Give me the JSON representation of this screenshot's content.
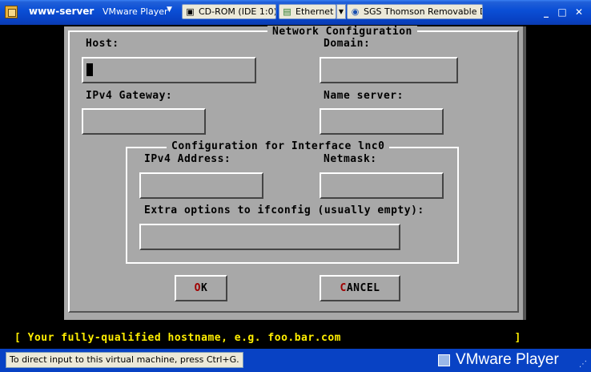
{
  "window": {
    "title": "www-server",
    "menu_label": "VMware Player",
    "devices": [
      {
        "label": "CD-ROM (IDE 1:0)",
        "icon": "cdrom-icon"
      },
      {
        "label": "Ethernet",
        "icon": "network-icon"
      },
      {
        "label": "SGS Thomson Removable Disk",
        "icon": "usb-disk-icon"
      }
    ],
    "controls": {
      "minimize": "_",
      "maximize": "□",
      "close": "✕"
    }
  },
  "dialog": {
    "title": "Network Configuration",
    "host_label": "Host:",
    "host_value": "",
    "domain_label": "Domain:",
    "domain_value": "",
    "gateway_label": "IPv4 Gateway:",
    "gateway_value": "",
    "nameserver_label": "Name server:",
    "nameserver_value": "",
    "interface": {
      "title": "Configuration for Interface lnc0",
      "ipv4_label": "IPv4 Address:",
      "ipv4_value": "",
      "netmask_label": "Netmask:",
      "netmask_value": "",
      "extra_label": "Extra options to ifconfig (usually empty):",
      "extra_value": ""
    },
    "ok": {
      "hotkey": "O",
      "rest": "K"
    },
    "cancel": {
      "hotkey": "C",
      "rest": "ANCEL"
    }
  },
  "status_line": "[ Your fully-qualified hostname, e.g. foo.bar.com                          ]",
  "bottom": {
    "hint": "To direct input to this virtual machine, press Ctrl+G.",
    "brand": "VMware Player"
  },
  "colors": {
    "titlebar": "#0b4fd6",
    "dialog_bg": "#a8a8a8",
    "hotkey": "#a00000",
    "status_text": "#ffee00"
  }
}
